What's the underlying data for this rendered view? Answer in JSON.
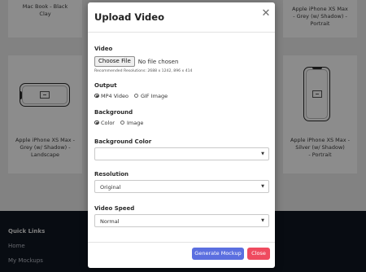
{
  "background": {
    "cards": [
      {
        "title_lines": [
          "Mac Book - Black",
          "Clay"
        ]
      },
      {
        "title_lines": [
          "Apple iPhone XS Max",
          "- Grey (w/ Shadow) -",
          "Portrait"
        ]
      },
      {
        "title_lines": [
          "Apple iPhone XS Max -",
          "Grey (w/ Shadow) -",
          "Landscape"
        ]
      },
      {
        "title_lines": [
          "Apple iPhone XS Max -",
          "Silver (w/ Shadow)",
          "- Portrait"
        ]
      }
    ],
    "footer": {
      "heading": "Quick Links",
      "links": [
        "Home",
        "My Mockups"
      ]
    }
  },
  "modal": {
    "title": "Upload Video",
    "close_icon": "close-icon",
    "video": {
      "label": "Video",
      "choose_file_label": "Choose File",
      "no_file_text": "No file chosen",
      "hint": "Recommended Resolutions: 2688 x 1242, 896 x 414"
    },
    "output": {
      "label": "Output",
      "options": [
        {
          "label": "MP4 Video",
          "checked": true
        },
        {
          "label": "GIF Image",
          "checked": false
        }
      ]
    },
    "background": {
      "label": "Background",
      "options": [
        {
          "label": "Color",
          "checked": true
        },
        {
          "label": "Image",
          "checked": false
        }
      ]
    },
    "background_color": {
      "label": "Background Color",
      "value": ""
    },
    "resolution": {
      "label": "Resolution",
      "value": "Original"
    },
    "video_speed": {
      "label": "Video Speed",
      "value": "Normal"
    },
    "buttons": {
      "generate": "Generate Mockup",
      "close": "Close"
    },
    "colors": {
      "primary": "#5b6fe0",
      "danger": "#ef4b5f"
    }
  }
}
